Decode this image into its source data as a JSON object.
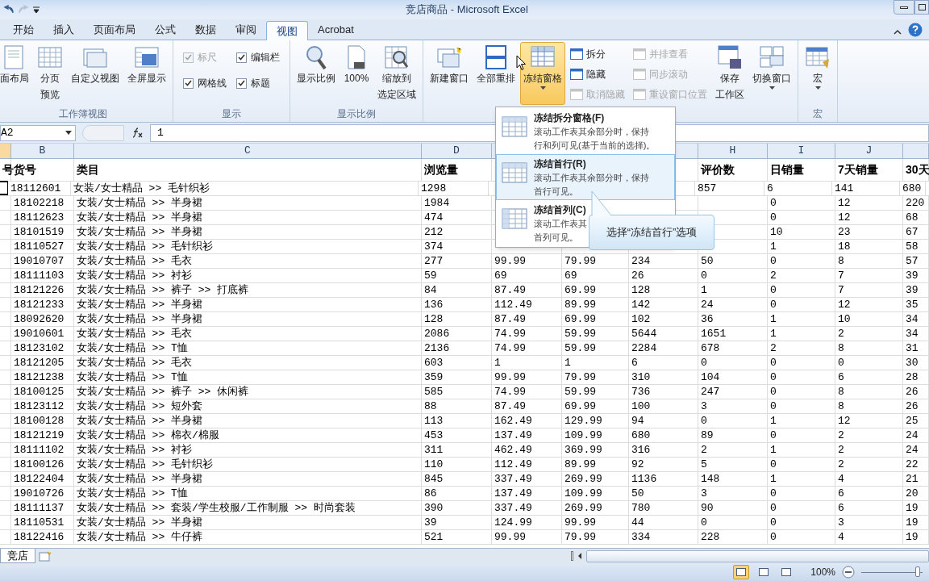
{
  "window": {
    "title": "竞店商品 - Microsoft Excel"
  },
  "tabs": [
    {
      "label": "开始",
      "selected": false
    },
    {
      "label": "插入",
      "selected": false
    },
    {
      "label": "页面布局",
      "selected": false
    },
    {
      "label": "公式",
      "selected": false
    },
    {
      "label": "数据",
      "selected": false
    },
    {
      "label": "审阅",
      "selected": false
    },
    {
      "label": "视图",
      "selected": true
    },
    {
      "label": "Acrobat",
      "selected": false
    }
  ],
  "ribbon_groups": [
    {
      "label": "工作簿视图",
      "items": [
        {
          "kind": "large",
          "lines": [
            "面布局"
          ],
          "pressed": false,
          "dropdown": false
        },
        {
          "kind": "large",
          "lines": [
            "分页",
            "预览"
          ],
          "pressed": false,
          "dropdown": false
        },
        {
          "kind": "large",
          "lines": [
            "自定义视图"
          ],
          "pressed": false,
          "dropdown": false
        },
        {
          "kind": "large",
          "lines": [
            "全屏显示"
          ],
          "pressed": false,
          "dropdown": false
        }
      ]
    },
    {
      "label": "显示",
      "items": [
        {
          "kind": "check",
          "label": "标尺",
          "checked": true,
          "disabled": true
        },
        {
          "kind": "check",
          "label": "编辑栏",
          "checked": true,
          "disabled": false
        },
        {
          "kind": "check",
          "label": "网格线",
          "checked": true,
          "disabled": false
        },
        {
          "kind": "check",
          "label": "标题",
          "checked": true,
          "disabled": false
        }
      ]
    },
    {
      "label": "显示比例",
      "items": [
        {
          "kind": "large",
          "lines": [
            "显示比例"
          ],
          "pressed": false,
          "dropdown": false
        },
        {
          "kind": "large",
          "lines": [
            "100%"
          ],
          "pressed": false,
          "dropdown": false
        },
        {
          "kind": "large",
          "lines": [
            "缩放到",
            "选定区域"
          ],
          "pressed": false,
          "dropdown": false
        }
      ]
    },
    {
      "items": [
        {
          "kind": "large",
          "lines": [
            "新建窗口"
          ],
          "pressed": false,
          "dropdown": false
        },
        {
          "kind": "large",
          "lines": [
            "全部重排"
          ],
          "pressed": false,
          "dropdown": false
        },
        {
          "kind": "large",
          "lines": [
            "冻结窗格"
          ],
          "pressed": true,
          "dropdown": true
        },
        {
          "kind": "small",
          "label": "拆分",
          "disabled": false
        },
        {
          "kind": "small",
          "label": "隐藏",
          "disabled": false
        },
        {
          "kind": "small",
          "label": "取消隐藏",
          "disabled": true
        },
        {
          "kind": "small",
          "label": "并排查看",
          "disabled": true
        },
        {
          "kind": "small",
          "label": "同步滚动",
          "disabled": true
        },
        {
          "kind": "small",
          "label": "重设窗口位置",
          "disabled": true
        },
        {
          "kind": "large",
          "lines": [
            "保存",
            "工作区"
          ],
          "pressed": false,
          "dropdown": false
        },
        {
          "kind": "large",
          "lines": [
            "切换窗口"
          ],
          "pressed": false,
          "dropdown": true
        }
      ]
    },
    {
      "label": "宏",
      "items": [
        {
          "kind": "large",
          "lines": [
            "宏"
          ],
          "pressed": false,
          "dropdown": true
        }
      ]
    }
  ],
  "formula_bar": {
    "name_box": "A2",
    "formula": "1"
  },
  "column_headers": [
    "B",
    "C",
    "D",
    "H",
    "I",
    "J"
  ],
  "header_row": [
    "号",
    "货号",
    "类目",
    "浏览量",
    "评价数",
    "日销量",
    "7天销量",
    "30天"
  ],
  "rows": [
    {
      "active": true,
      "cells": [
        {},
        {
          "text": "18112601"
        },
        {
          "text": "女装/女士精品 >> 毛针织衫"
        },
        {
          "text": "1298"
        },
        {},
        {},
        {},
        {
          "text": "857"
        },
        {
          "text": "6"
        },
        {
          "text": "141"
        },
        {
          "text": "680"
        }
      ]
    },
    {
      "active": false,
      "cells": [
        {},
        {
          "text": "18102218"
        },
        {
          "text": "女装/女士精品 >> 半身裙"
        },
        {
          "text": "1984"
        },
        {},
        {},
        {},
        {},
        {
          "text": "0"
        },
        {
          "text": "12"
        },
        {
          "text": "220"
        }
      ]
    },
    {
      "active": false,
      "cells": [
        {},
        {
          "text": "18112623"
        },
        {
          "text": "女装/女士精品 >> 半身裙"
        },
        {
          "text": "474"
        },
        {},
        {},
        {},
        {},
        {
          "text": "0"
        },
        {
          "text": "12"
        },
        {
          "text": "68"
        }
      ]
    },
    {
      "active": false,
      "cells": [
        {},
        {
          "text": "18101519"
        },
        {
          "text": "女装/女士精品 >> 半身裙"
        },
        {
          "text": "212"
        },
        {},
        {},
        {},
        {},
        {
          "text": "10"
        },
        {
          "text": "23"
        },
        {
          "text": "67"
        }
      ]
    },
    {
      "active": false,
      "cells": [
        {},
        {
          "text": "18110527"
        },
        {
          "text": "女装/女士精品 >> 毛针织衫"
        },
        {
          "text": "374"
        },
        {},
        {},
        {},
        {},
        {
          "text": "1"
        },
        {
          "text": "18"
        },
        {
          "text": "58"
        }
      ]
    },
    {
      "active": false,
      "cells": [
        {},
        {
          "text": "19010707"
        },
        {
          "text": "女装/女士精品 >> 毛衣"
        },
        {
          "text": "277"
        },
        {
          "text": "99.99"
        },
        {
          "text": "79.99"
        },
        {
          "text": "234"
        },
        {
          "text": "50"
        },
        {
          "text": "0"
        },
        {
          "text": "8"
        },
        {
          "text": "57"
        }
      ]
    },
    {
      "active": false,
      "cells": [
        {},
        {
          "text": "18111103"
        },
        {
          "text": "女装/女士精品 >> 衬衫"
        },
        {
          "text": "59"
        },
        {
          "text": "69"
        },
        {
          "text": "69"
        },
        {
          "text": "26"
        },
        {
          "text": "0"
        },
        {
          "text": "2"
        },
        {
          "text": "7"
        },
        {
          "text": "39"
        }
      ]
    },
    {
      "active": false,
      "cells": [
        {},
        {
          "text": "18121226"
        },
        {
          "text": "女装/女士精品 >> 裤子 >> 打底裤"
        },
        {
          "text": "84"
        },
        {
          "text": "87.49"
        },
        {
          "text": "69.99"
        },
        {
          "text": "128"
        },
        {
          "text": "1"
        },
        {
          "text": "0"
        },
        {
          "text": "7"
        },
        {
          "text": "39"
        }
      ]
    },
    {
      "active": false,
      "cells": [
        {},
        {
          "text": "18121233"
        },
        {
          "text": "女装/女士精品 >> 半身裙"
        },
        {
          "text": "136"
        },
        {
          "text": "112.49"
        },
        {
          "text": "89.99"
        },
        {
          "text": "142"
        },
        {
          "text": "24"
        },
        {
          "text": "0"
        },
        {
          "text": "12"
        },
        {
          "text": "35"
        }
      ]
    },
    {
      "active": false,
      "cells": [
        {},
        {
          "text": "18092620"
        },
        {
          "text": "女装/女士精品 >> 半身裙"
        },
        {
          "text": "128"
        },
        {
          "text": "87.49"
        },
        {
          "text": "69.99"
        },
        {
          "text": "102"
        },
        {
          "text": "36"
        },
        {
          "text": "1"
        },
        {
          "text": "10"
        },
        {
          "text": "34"
        }
      ]
    },
    {
      "active": false,
      "cells": [
        {},
        {
          "text": "19010601"
        },
        {
          "text": "女装/女士精品 >> 毛衣"
        },
        {
          "text": "2086"
        },
        {
          "text": "74.99"
        },
        {
          "text": "59.99"
        },
        {
          "text": "5644"
        },
        {
          "text": "1651"
        },
        {
          "text": "1"
        },
        {
          "text": "2"
        },
        {
          "text": "34"
        }
      ]
    },
    {
      "active": false,
      "cells": [
        {},
        {
          "text": "18123102"
        },
        {
          "text": "女装/女士精品 >> T恤"
        },
        {
          "text": "2136"
        },
        {
          "text": "74.99"
        },
        {
          "text": "59.99"
        },
        {
          "text": "2284"
        },
        {
          "text": "678"
        },
        {
          "text": "2"
        },
        {
          "text": "8"
        },
        {
          "text": "31"
        }
      ]
    },
    {
      "active": false,
      "cells": [
        {},
        {
          "text": "18121205"
        },
        {
          "text": "女装/女士精品 >> 毛衣"
        },
        {
          "text": "603"
        },
        {
          "text": "1"
        },
        {
          "text": "1"
        },
        {
          "text": "6"
        },
        {
          "text": "0"
        },
        {
          "text": "0"
        },
        {
          "text": "0"
        },
        {
          "text": "30"
        }
      ]
    },
    {
      "active": false,
      "cells": [
        {},
        {
          "text": "18121238"
        },
        {
          "text": "女装/女士精品 >> T恤"
        },
        {
          "text": "359"
        },
        {
          "text": "99.99"
        },
        {
          "text": "79.99"
        },
        {
          "text": "310"
        },
        {
          "text": "104"
        },
        {
          "text": "0"
        },
        {
          "text": "6"
        },
        {
          "text": "28"
        }
      ]
    },
    {
      "active": false,
      "cells": [
        {},
        {
          "text": "18100125"
        },
        {
          "text": "女装/女士精品 >> 裤子 >> 休闲裤"
        },
        {
          "text": "585"
        },
        {
          "text": "74.99"
        },
        {
          "text": "59.99"
        },
        {
          "text": "736"
        },
        {
          "text": "247"
        },
        {
          "text": "0"
        },
        {
          "text": "8"
        },
        {
          "text": "26"
        }
      ]
    },
    {
      "active": false,
      "cells": [
        {},
        {
          "text": "18123112"
        },
        {
          "text": "女装/女士精品 >> 短外套"
        },
        {
          "text": "88"
        },
        {
          "text": "87.49"
        },
        {
          "text": "69.99"
        },
        {
          "text": "100"
        },
        {
          "text": "3"
        },
        {
          "text": "0"
        },
        {
          "text": "8"
        },
        {
          "text": "26"
        }
      ]
    },
    {
      "active": false,
      "cells": [
        {},
        {
          "text": "18100128"
        },
        {
          "text": "女装/女士精品 >> 半身裙"
        },
        {
          "text": "113"
        },
        {
          "text": "162.49"
        },
        {
          "text": "129.99"
        },
        {
          "text": "94"
        },
        {
          "text": "0"
        },
        {
          "text": "1"
        },
        {
          "text": "12"
        },
        {
          "text": "25"
        }
      ]
    },
    {
      "active": false,
      "cells": [
        {},
        {
          "text": "18121219"
        },
        {
          "text": "女装/女士精品 >> 棉衣/棉服"
        },
        {
          "text": "453"
        },
        {
          "text": "137.49"
        },
        {
          "text": "109.99"
        },
        {
          "text": "680"
        },
        {
          "text": "89"
        },
        {
          "text": "0"
        },
        {
          "text": "2"
        },
        {
          "text": "24"
        }
      ]
    },
    {
      "active": false,
      "cells": [
        {},
        {
          "text": "18111102"
        },
        {
          "text": "女装/女士精品 >> 衬衫"
        },
        {
          "text": "311"
        },
        {
          "text": "462.49"
        },
        {
          "text": "369.99"
        },
        {
          "text": "316"
        },
        {
          "text": "2"
        },
        {
          "text": "1"
        },
        {
          "text": "2"
        },
        {
          "text": "24"
        }
      ]
    },
    {
      "active": false,
      "cells": [
        {},
        {
          "text": "18100126"
        },
        {
          "text": "女装/女士精品 >> 毛针织衫"
        },
        {
          "text": "110"
        },
        {
          "text": "112.49"
        },
        {
          "text": "89.99"
        },
        {
          "text": "92"
        },
        {
          "text": "5"
        },
        {
          "text": "0"
        },
        {
          "text": "2"
        },
        {
          "text": "22"
        }
      ]
    },
    {
      "active": false,
      "cells": [
        {},
        {
          "text": "18122404"
        },
        {
          "text": "女装/女士精品 >> 半身裙"
        },
        {
          "text": "845"
        },
        {
          "text": "337.49"
        },
        {
          "text": "269.99"
        },
        {
          "text": "1136"
        },
        {
          "text": "148"
        },
        {
          "text": "1"
        },
        {
          "text": "4"
        },
        {
          "text": "21"
        }
      ]
    },
    {
      "active": false,
      "cells": [
        {},
        {
          "text": "19010726"
        },
        {
          "text": "女装/女士精品 >> T恤"
        },
        {
          "text": "86"
        },
        {
          "text": "137.49"
        },
        {
          "text": "109.99"
        },
        {
          "text": "50"
        },
        {
          "text": "3"
        },
        {
          "text": "0"
        },
        {
          "text": "6"
        },
        {
          "text": "20"
        }
      ]
    },
    {
      "active": false,
      "cells": [
        {},
        {
          "text": "18111137"
        },
        {
          "text": "女装/女士精品 >> 套装/学生校服/工作制服 >> 时尚套装"
        },
        {
          "text": "390"
        },
        {
          "text": "337.49"
        },
        {
          "text": "269.99"
        },
        {
          "text": "780"
        },
        {
          "text": "90"
        },
        {
          "text": "0"
        },
        {
          "text": "6"
        },
        {
          "text": "19"
        }
      ]
    },
    {
      "active": false,
      "cells": [
        {},
        {
          "text": "18110531"
        },
        {
          "text": "女装/女士精品 >> 半身裙"
        },
        {
          "text": "39"
        },
        {
          "text": "124.99"
        },
        {
          "text": "99.99"
        },
        {
          "text": "44"
        },
        {
          "text": "0"
        },
        {
          "text": "0"
        },
        {
          "text": "3"
        },
        {
          "text": "19"
        }
      ]
    },
    {
      "active": false,
      "cells": [
        {},
        {
          "text": "18122416"
        },
        {
          "text": "女装/女士精品 >> 牛仔裤"
        },
        {
          "text": "521"
        },
        {
          "text": "99.99"
        },
        {
          "text": "79.99"
        },
        {
          "text": "334"
        },
        {
          "text": "228"
        },
        {
          "text": "0"
        },
        {
          "text": "4"
        },
        {
          "text": "19"
        }
      ]
    }
  ],
  "freeze_menu": {
    "items": [
      {
        "title": "冻结拆分窗格(F)",
        "desc_lines": [
          "滚动工作表其余部分时，保持",
          "行和列可见(基于当前的选择)。"
        ],
        "selected": false
      },
      {
        "title": "冻结首行(R)",
        "desc_lines": [
          "滚动工作表其余部分时，保持",
          "首行可见。"
        ],
        "selected": true
      },
      {
        "title": "冻结首列(C)",
        "desc_lines": [
          "滚动工作表其",
          "首列可见。"
        ],
        "selected": false
      }
    ]
  },
  "callout": {
    "text": "选择“冻结首行”选项"
  },
  "sheet_tabs": [
    {
      "label": "竞店",
      "selected": true
    }
  ],
  "status_bar": {
    "views": [
      {
        "selected": true
      },
      {
        "selected": false
      },
      {
        "selected": false
      }
    ],
    "zoom": "100%",
    "zoom_slider": {
      "level": 0.92
    }
  }
}
